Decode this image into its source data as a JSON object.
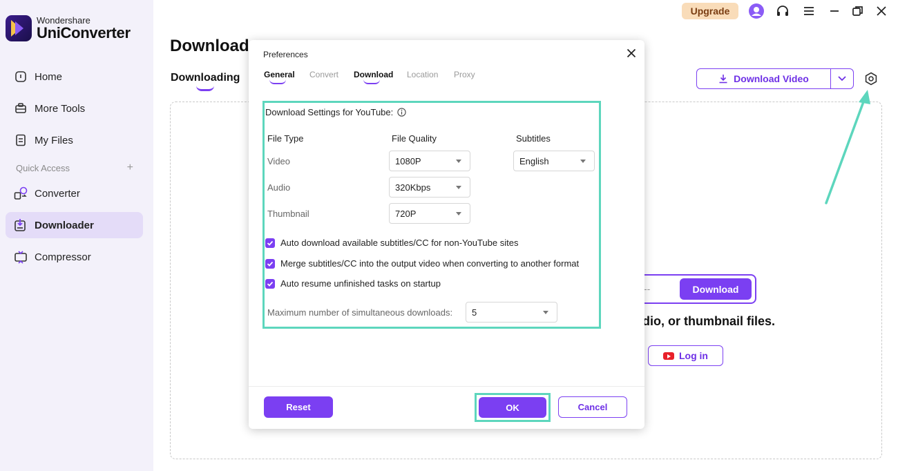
{
  "app": {
    "brand_small": "Wondershare",
    "brand_big": "UniConverter"
  },
  "sidebar": {
    "items": [
      {
        "label": "Home",
        "icon": "home-icon"
      },
      {
        "label": "More Tools",
        "icon": "toolbox-icon"
      },
      {
        "label": "My Files",
        "icon": "file-icon"
      }
    ],
    "quick_access_label": "Quick Access",
    "quick_items": [
      {
        "label": "Converter",
        "icon": "converter-icon"
      },
      {
        "label": "Downloader",
        "icon": "downloader-icon",
        "active": true
      },
      {
        "label": "Compressor",
        "icon": "compressor-icon"
      }
    ]
  },
  "topbar": {
    "upgrade_label": "Upgrade",
    "icons": [
      "avatar-icon",
      "headset-icon",
      "menu-icon",
      "minimize-icon",
      "restore-icon",
      "close-icon"
    ]
  },
  "main": {
    "title": "Downloader",
    "tab_label": "Downloading",
    "download_video_label": "Download Video",
    "url_placeholder": "--",
    "url_download_label": "Download",
    "caption": "dio, or thumbnail files.",
    "login_label": "Log in"
  },
  "dialog": {
    "title": "Preferences",
    "tabs": [
      {
        "label": "General",
        "active": true
      },
      {
        "label": "Convert",
        "active": false
      },
      {
        "label": "Download",
        "active": true
      },
      {
        "label": "Location",
        "active": false
      },
      {
        "label": "Proxy",
        "active": false
      }
    ],
    "heading": "Download Settings for YouTube:",
    "columns": {
      "file_type": "File Type",
      "file_quality": "File Quality",
      "subtitles": "Subtitles"
    },
    "rows": [
      {
        "label": "Video",
        "quality": "1080P"
      },
      {
        "label": "Audio",
        "quality": "320Kbps"
      },
      {
        "label": "Thumbnail",
        "quality": "720P"
      }
    ],
    "subtitle_value": "English",
    "checkboxes": [
      {
        "label": "Auto download available subtitles/CC for non-YouTube sites",
        "checked": true
      },
      {
        "label": "Merge subtitles/CC into the output video when converting to another format",
        "checked": true
      },
      {
        "label": "Auto resume unfinished tasks on startup",
        "checked": true
      }
    ],
    "max_downloads_label": "Maximum number of simultaneous downloads:",
    "max_downloads_value": "5",
    "reset_label": "Reset",
    "ok_label": "OK",
    "cancel_label": "Cancel"
  },
  "colors": {
    "accent": "#7b3ff2",
    "highlight": "#5dd6bd",
    "sidebar_bg": "#f3f1fa",
    "upgrade_bg": "#f9dcb9"
  }
}
